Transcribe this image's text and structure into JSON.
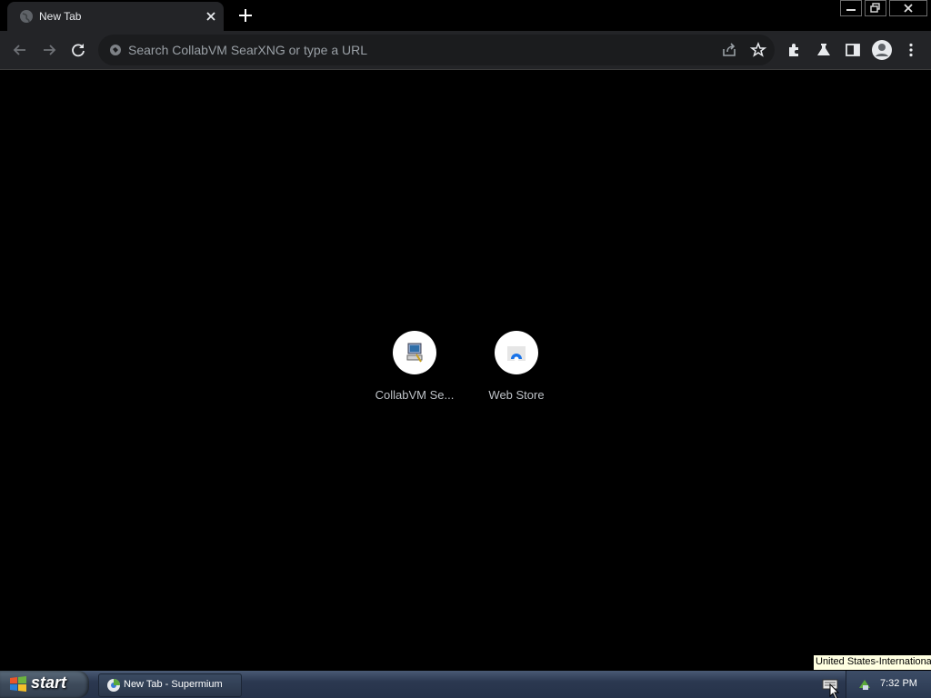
{
  "browser": {
    "tab": {
      "title": "New Tab"
    },
    "omnibox": {
      "placeholder": "Search CollabVM SearXNG or type a URL"
    }
  },
  "ntp": {
    "shortcuts": [
      {
        "label": "CollabVM Se..."
      },
      {
        "label": "Web Store"
      }
    ]
  },
  "taskbar": {
    "start_label": "start",
    "task_item": "New Tab - Supermium",
    "clock": "7:32 PM",
    "tooltip": "United States-International"
  },
  "colors": {
    "toolbar_bg": "#232427",
    "tab_bg": "#232427",
    "omnibox_bg": "#1b1c1e",
    "page_bg": "#000000",
    "taskbar": "#2b3850"
  }
}
